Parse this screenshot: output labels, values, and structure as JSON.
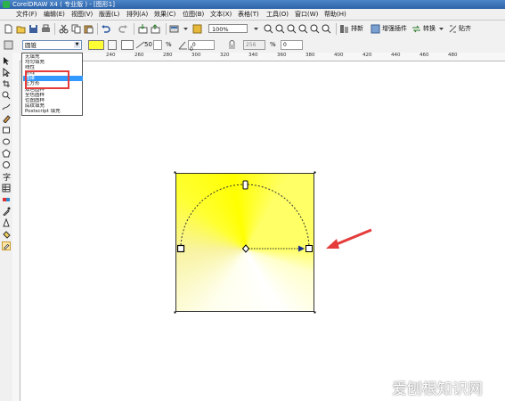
{
  "window": {
    "title": "CorelDRAW X4 ( 专业版 ) - [图形1]"
  },
  "menu": [
    "文件(F)",
    "编辑(E)",
    "视图(V)",
    "版面(L)",
    "排列(A)",
    "效果(C)",
    "位图(B)",
    "文本(X)",
    "表格(T)",
    "工具(O)",
    "窗口(W)",
    "帮助(H)"
  ],
  "toolbar": {
    "zoom_value": "100%",
    "arrange_label": "排新",
    "plugins_label": "增强插件",
    "convert_label": "转换",
    "paste_label": "贴齐"
  },
  "property_bar": {
    "fill_type_value": "圆锥",
    "midpoint_value": "50",
    "angle_value": ".0",
    "offset_value": "0",
    "steps_value": "256",
    "percent_label": "%",
    "offset_values": [
      "0",
      "0"
    ]
  },
  "ruler": {
    "top_labels": [
      "240",
      "260",
      "280",
      "300",
      "320",
      "340",
      "360",
      "380",
      "400",
      "420",
      "440",
      "460",
      "480"
    ]
  },
  "fill_dropdown": {
    "items": [
      "无填充",
      "均匀填充",
      "线性",
      "射线",
      "圆锥",
      "正方形",
      "双色图样",
      "全色图样",
      "位图图样",
      "底纹填充",
      "Postscript 填充"
    ],
    "selected_index": 4
  },
  "colors": {
    "fill_start": "#ffff00",
    "fill_end": "#ffffff",
    "arrow": "#e53b3b",
    "highlight": "#e53b3b"
  },
  "watermark": "爱刨根知识网"
}
